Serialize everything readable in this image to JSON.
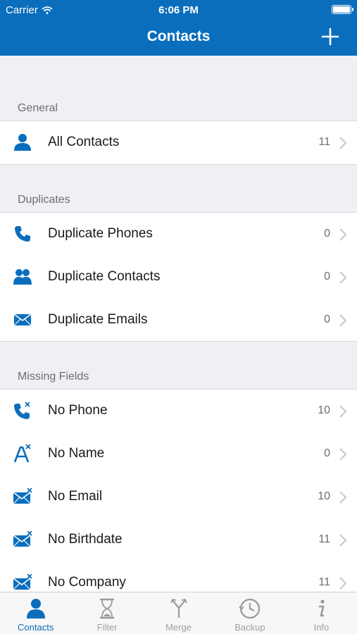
{
  "status_bar": {
    "carrier": "Carrier",
    "time": "6:06 PM",
    "battery_level": 1.0
  },
  "nav": {
    "title": "Contacts",
    "add_icon": "plus-icon"
  },
  "colors": {
    "accent": "#0a6ebd",
    "background": "#efeff4",
    "inactive": "#a0a0a0"
  },
  "sections": [
    {
      "header": "General",
      "rows": [
        {
          "label": "All Contacts",
          "count": "11",
          "icon": "person-icon"
        }
      ]
    },
    {
      "header": "Duplicates",
      "rows": [
        {
          "label": "Duplicate Phones",
          "count": "0",
          "icon": "phone-icon"
        },
        {
          "label": "Duplicate Contacts",
          "count": "0",
          "icon": "people-icon"
        },
        {
          "label": "Duplicate Emails",
          "count": "0",
          "icon": "envelope-icon"
        }
      ]
    },
    {
      "header": "Missing Fields",
      "rows": [
        {
          "label": "No Phone",
          "count": "10",
          "icon": "phone-x-icon"
        },
        {
          "label": "No Name",
          "count": "0",
          "icon": "letter-a-x-icon"
        },
        {
          "label": "No Email",
          "count": "10",
          "icon": "envelope-x-icon"
        },
        {
          "label": "No Birthdate",
          "count": "11",
          "icon": "envelope-x-icon"
        },
        {
          "label": "No Company",
          "count": "11",
          "icon": "envelope-x-icon"
        }
      ]
    }
  ],
  "tabs": [
    {
      "label": "Contacts",
      "icon": "person-icon",
      "active": true
    },
    {
      "label": "Filter",
      "icon": "hourglass-icon",
      "active": false
    },
    {
      "label": "Merge",
      "icon": "merge-icon",
      "active": false
    },
    {
      "label": "Backup",
      "icon": "clock-icon",
      "active": false
    },
    {
      "label": "Info",
      "icon": "info-icon",
      "active": false
    }
  ]
}
